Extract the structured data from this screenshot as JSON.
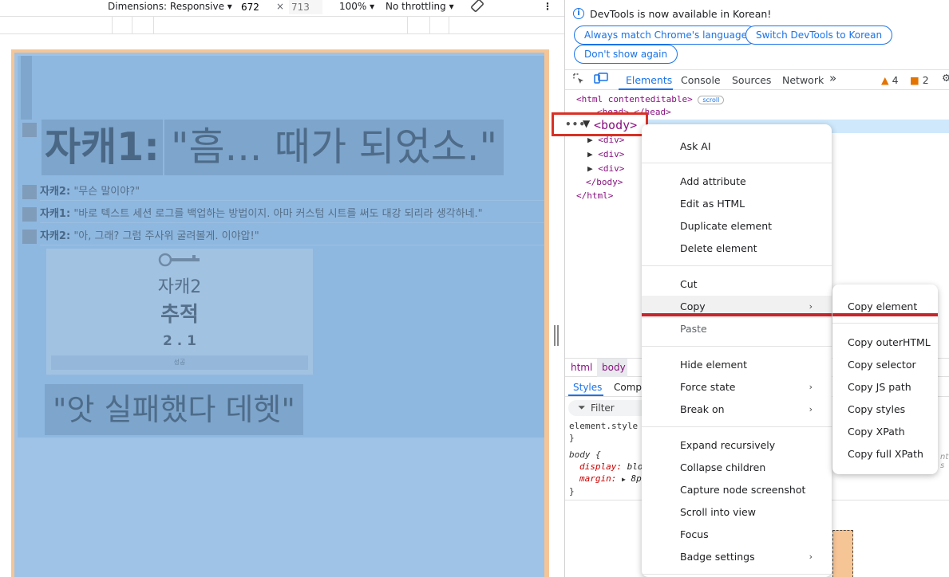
{
  "device_toolbar": {
    "dimensions_label": "Dimensions: Responsive",
    "width_value": "672",
    "times": "×",
    "height_placeholder": "713",
    "zoom": "100%",
    "throttling": "No throttling",
    "more": "⋮"
  },
  "page": {
    "title_speaker": "자캐1:",
    "title_text": "\"흠... 때가 되었소.\"",
    "lines": [
      {
        "speaker": "자캐2:",
        "text": "\"무슨 말이야?\""
      },
      {
        "speaker": "자캐1:",
        "text": "\"바로 텍스트 세션 로그를 백업하는 방법이지. 아마 커스텀 시트를 써도 대강 되리라 생각하네.\""
      },
      {
        "speaker": "자캐2:",
        "text": "\"아, 그래? 그럼 주사위 굴려볼게. 이야압!\""
      }
    ],
    "card": {
      "name": "자캐2",
      "skill": "추적",
      "result": "2 . 1",
      "footer": "성공"
    },
    "fail_text": "\"앗 실패했다 데헷\""
  },
  "devtools": {
    "info": {
      "message": "DevTools is now available in Korean!",
      "btn_match": "Always match Chrome's language",
      "btn_switch": "Switch DevTools to Korean",
      "btn_dont_show": "Don't show again"
    },
    "tabs": {
      "elements": "Elements",
      "console": "Console",
      "sources": "Sources",
      "network": "Network",
      "more": "»",
      "warnings": "4",
      "errors": "2"
    },
    "dom": {
      "html_open": "<html contenteditable>",
      "scroll_badge": "scroll",
      "head_partial": "<head> </head>",
      "body_tag": "<body>",
      "div1": "<div>",
      "div2": "<div>",
      "div3": "<div>",
      "body_close": "</body>",
      "html_close": "</html>"
    },
    "breadcrumbs": {
      "html": "html",
      "body": "body"
    },
    "styles_tabs": {
      "styles": "Styles",
      "computed": "Compu"
    },
    "filter": "Filter",
    "styles_text": {
      "element_style": "element.style {",
      "close1": "}",
      "body_sel": "body {",
      "prop1": "display",
      "val1": "bloc",
      "prop2": "margin",
      "val2": "8p",
      "close2": "}",
      "right_hint": "nt s"
    }
  },
  "context_menu": {
    "items": {
      "ask_ai": "Ask AI",
      "add_attribute": "Add attribute",
      "edit_as_html": "Edit as HTML",
      "duplicate_element": "Duplicate element",
      "delete_element": "Delete element",
      "cut": "Cut",
      "copy": "Copy",
      "paste": "Paste",
      "hide_element": "Hide element",
      "force_state": "Force state",
      "break_on": "Break on",
      "expand_recursively": "Expand recursively",
      "collapse_children": "Collapse children",
      "capture_node_screenshot": "Capture node screenshot",
      "scroll_into_view": "Scroll into view",
      "focus": "Focus",
      "badge_settings": "Badge settings"
    },
    "submenu_arrow": "›"
  },
  "copy_submenu": {
    "items": [
      "Copy element",
      "Copy outerHTML",
      "Copy selector",
      "Copy JS path",
      "Copy styles",
      "Copy XPath",
      "Copy full XPath"
    ]
  }
}
